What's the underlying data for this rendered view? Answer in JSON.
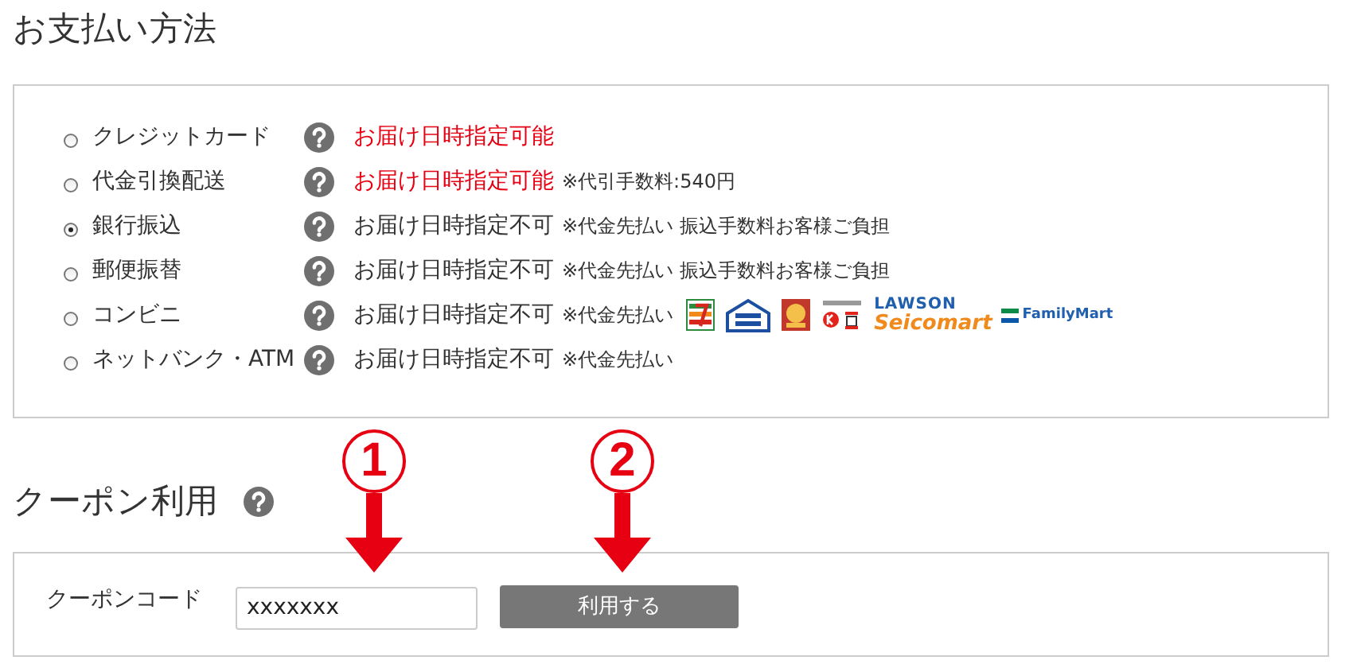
{
  "payment": {
    "title": "お支払い方法",
    "methods": [
      {
        "label": "クレジットカード",
        "selected": false,
        "delivery": "お届け日時指定可能",
        "delivery_ok": true
      },
      {
        "label": "代金引換配送",
        "selected": false,
        "delivery": "お届け日時指定可能",
        "delivery_ok": true,
        "note": "※代引手数料:540円"
      },
      {
        "label": "銀行振込",
        "selected": true,
        "delivery": "お届け日時指定不可",
        "delivery_ok": false,
        "note": "※代金先払い 振込手数料お客様ご負担"
      },
      {
        "label": "郵便振替",
        "selected": false,
        "delivery": "お届け日時指定不可",
        "delivery_ok": false,
        "note": "※代金先払い 振込手数料お客様ご負担"
      },
      {
        "label": "コンビニ",
        "selected": false,
        "delivery": "お届け日時指定不可",
        "delivery_ok": false,
        "note": "※代金先払い",
        "logos": [
          {
            "kind": "seven"
          },
          {
            "kind": "ministop"
          },
          {
            "kind": "daily"
          },
          {
            "kind": "circlek"
          },
          {
            "kind": "stacked",
            "lines": [
              "LAWSON",
              "Seicomart"
            ]
          },
          {
            "kind": "familymart",
            "text": "FamilyMart"
          }
        ]
      },
      {
        "label": "ネットバンク・ATM",
        "selected": false,
        "delivery": "お届け日時指定不可",
        "delivery_ok": false,
        "note": "※代金先払い"
      }
    ]
  },
  "coupon": {
    "title": "クーポン利用",
    "field_label": "クーポンコード",
    "value": "xxxxxxx",
    "button": "利用する"
  },
  "annotations": [
    {
      "number": "1"
    },
    {
      "number": "2"
    }
  ]
}
